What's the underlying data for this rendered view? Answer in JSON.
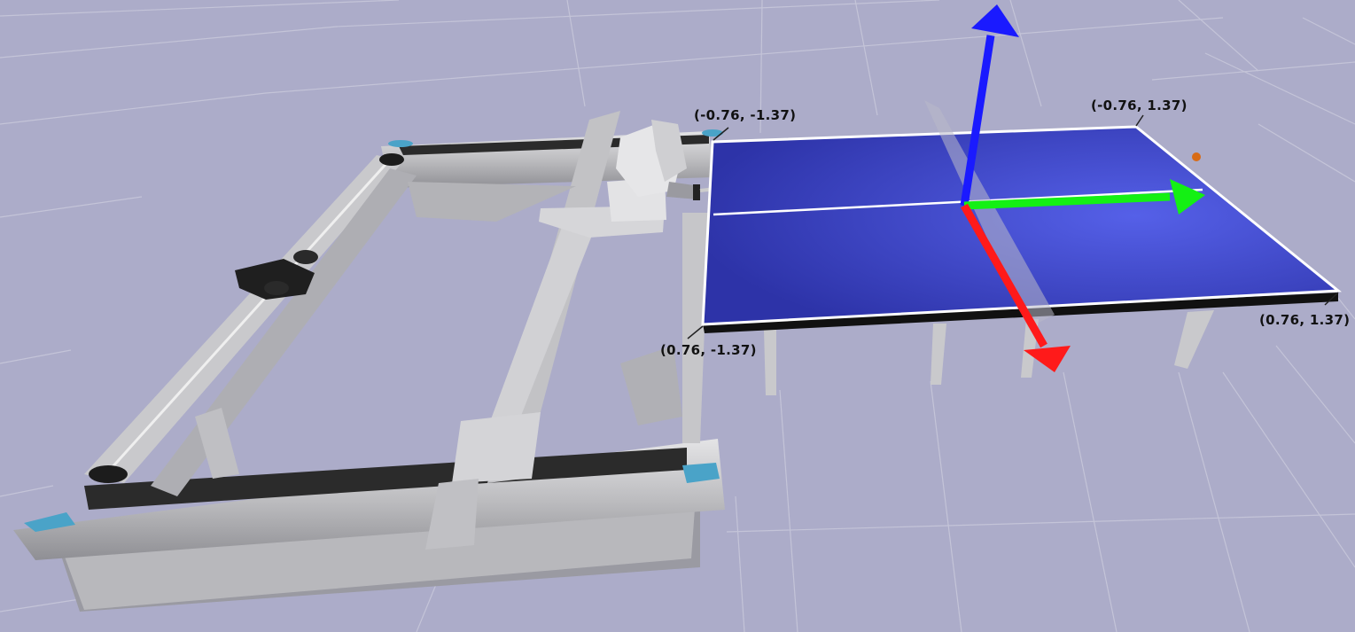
{
  "scene": {
    "background": "#acacc9",
    "grid_color": "#c4c4d8",
    "table_color": "#3c43b8",
    "table_line_color": "#ffffff",
    "net_color": "#b9b9c9",
    "frame_color": "#c7c7c9",
    "frame_dark": "#2b2b2b",
    "accent_pad_color": "#4aa3c8",
    "ball_color": "#d86b16",
    "robot_color": "#e2e2e2"
  },
  "axes": {
    "x_axis_color": "#ff1a1a",
    "y_axis_color": "#14f014",
    "z_axis_color": "#1a1aff"
  },
  "corner_labels": {
    "far_left": "(-0.76, -1.37)",
    "far_right": "(-0.76, 1.37)",
    "near_left": "(0.76, -1.37)",
    "near_right": "(0.76, 1.37)"
  }
}
